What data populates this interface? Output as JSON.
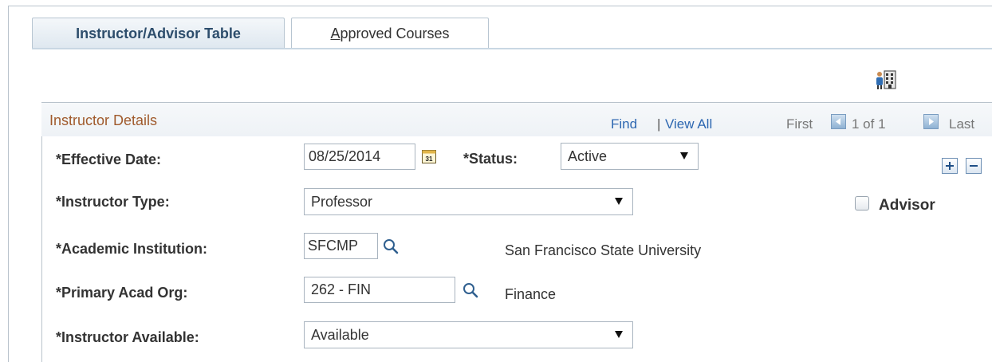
{
  "tabs": [
    {
      "label": "Instructor/Advisor Table",
      "active": true
    },
    {
      "label_first": "A",
      "label_rest": "pproved Courses",
      "active": false
    }
  ],
  "icons": {
    "org_chart": "org-chart-icon",
    "calendar": "calendar-icon",
    "lookup": "magnifier-icon",
    "add_row": "plus-icon",
    "delete_row": "minus-icon"
  },
  "colors": {
    "section_title": "#a05a2c",
    "link": "#2d67b1",
    "active_tab_text": "#2d4d6c"
  },
  "section": {
    "title": "Instructor Details",
    "find": "Find",
    "separator": "|",
    "view_all": "View All",
    "first": "First",
    "count": "1 of 1",
    "last": "Last"
  },
  "form": {
    "effective_date": {
      "label": "*Effective Date:",
      "value": "08/25/2014"
    },
    "status": {
      "label": "*Status:",
      "value": "Active"
    },
    "instructor_type": {
      "label": "*Instructor Type:",
      "value": "Professor"
    },
    "advisor": {
      "label": "Advisor",
      "checked": false
    },
    "academic_institution": {
      "label": "*Academic Institution:",
      "value": "SFCMP",
      "description": "San Francisco State University"
    },
    "primary_acad_org": {
      "label": "*Primary Acad Org:",
      "value": "262 - FIN",
      "description": "Finance"
    },
    "instructor_available": {
      "label": "*Instructor Available:",
      "value": "Available"
    }
  }
}
